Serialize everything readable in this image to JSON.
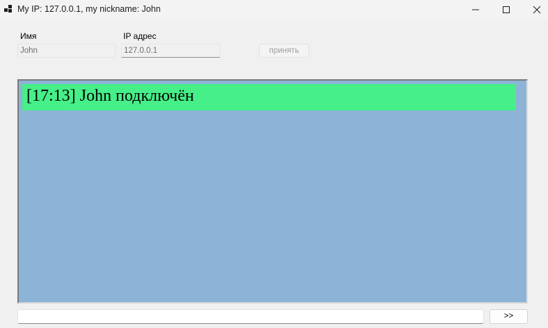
{
  "window": {
    "title": "My IP: 127.0.0.1, my nickname: John"
  },
  "form": {
    "name_label": "Имя",
    "name_value": "John",
    "ip_label": "IP адрес",
    "ip_value": "127.0.0.1",
    "accept_label": "принять"
  },
  "chat": {
    "messages": [
      {
        "text": "[17:13] John подключён",
        "color": "#46ef88"
      }
    ],
    "background": "#8db3d6"
  },
  "composer": {
    "input_value": "",
    "send_label": ">>"
  }
}
